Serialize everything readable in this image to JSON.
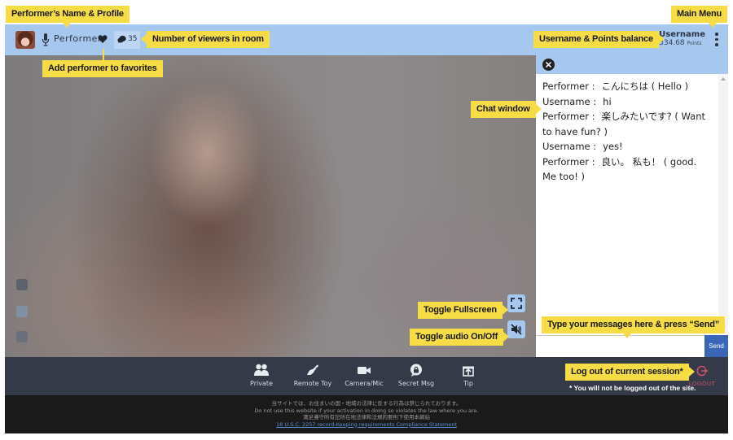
{
  "header": {
    "performer_name": "Performer",
    "viewer_count": "35",
    "username": "Username",
    "points_value": "334.68",
    "points_unit": "Points"
  },
  "chat": {
    "messages": [
      {
        "sender": "Performer :",
        "text": "こんにちは ( Hello )"
      },
      {
        "sender": "Username :",
        "text": "hi"
      },
      {
        "sender": "Performer :",
        "text": "楽しみたいです? ( Want to have fun? )"
      },
      {
        "sender": "Username :",
        "text": "yes!"
      },
      {
        "sender": "Performer :",
        "text": "良い。 私も！ ( good. Me too! )"
      }
    ],
    "input_value": "",
    "input_placeholder": "",
    "send_label": "Send"
  },
  "actions": [
    {
      "id": "private",
      "label": "Private",
      "icon": "users-icon"
    },
    {
      "id": "remote-toy",
      "label": "Remote Toy",
      "icon": "toy-icon"
    },
    {
      "id": "camera-mic",
      "label": "Camera/Mic",
      "icon": "video-camera-icon"
    },
    {
      "id": "secret-msg",
      "label": "Secret Msg",
      "icon": "lock-bubble-icon"
    },
    {
      "id": "tip",
      "label": "Tip",
      "icon": "gift-icon"
    }
  ],
  "logout_label": "LOGOUT",
  "footer": {
    "line1": "当サイトでは、お住まいの国・地域の法律に反する行為は禁じられております。",
    "line2": "Do not use this website if your activation in doing so violates the law where you are.",
    "line3": "満足遵守所有記所在地法律和法規的要則下使用本網站",
    "compliance_link": "18 U.S.C. 2257 record-Keeping requirements Compliance Statement"
  },
  "annotations": {
    "performer_profile": "Performer’s Name & Profile",
    "viewers": "Number of viewers in room",
    "favorites": "Add  performer to favorites",
    "main_menu": "Main Menu",
    "username_points": "Username & Points balance",
    "chat_window": "Chat window",
    "fullscreen": "Toggle Fullscreen",
    "audio": "Toggle audio On/Off",
    "type_message": "Type your messages here & press “Send”",
    "logout": "Log out of current session*",
    "logout_note": "* You will not be logged out of the site."
  },
  "colors": {
    "topbar": "#a6c8ef",
    "annotation": "#f6dc45",
    "send_button": "#3a66b8",
    "action_bar": "#343a47",
    "footer": "#1a1a1a",
    "logout": "#c9516a"
  }
}
